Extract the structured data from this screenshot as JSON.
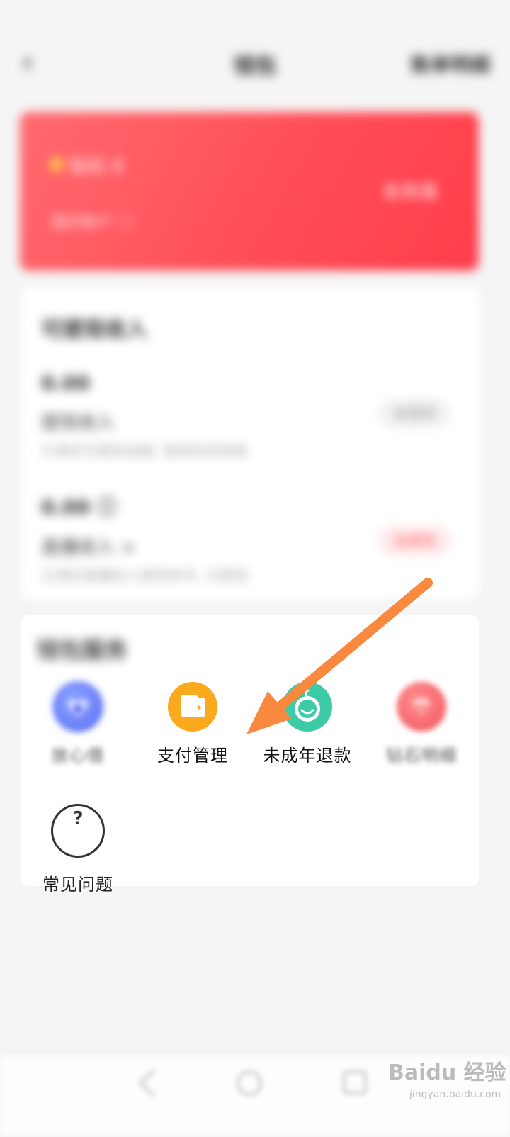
{
  "header": {
    "back_icon": "chevron-left-icon",
    "title": "钱包",
    "detail_link": "账单明细"
  },
  "wallet_card": {
    "balance_label": "钻石 0",
    "recharge_label": "去充值",
    "sub_label": "我的账户 ⓘ"
  },
  "income_card": {
    "heading": "可提现收入",
    "row1": {
      "title": "0.00",
      "sub": "提现收入",
      "desc": "已满足可提现金额, 提现后将到账",
      "button": "去提现"
    },
    "row2": {
      "title": "0.00 ⓘ",
      "sub": "直播收入 >",
      "desc": "已满足直播收入提现条件, 可提现",
      "button": "去提现"
    }
  },
  "services": {
    "title": "钱包服务",
    "items": [
      {
        "label": "放心借",
        "icon": "heart-shield-icon"
      },
      {
        "label": "支付管理",
        "icon": "wallet-icon"
      },
      {
        "label": "未成年退款",
        "icon": "baby-face-icon"
      },
      {
        "label": "钻石明细",
        "icon": "diamond-icon"
      },
      {
        "label": "常见问题",
        "icon": "question-circle-icon"
      }
    ]
  },
  "watermark": {
    "text": "Baidu 经验",
    "sub": "jingyan.baidu.com"
  },
  "colors": {
    "card_red": "#ff4e57",
    "arrow": "#f9893f",
    "orange_icon": "#fbaa1e",
    "green_icon": "#3ccba6"
  }
}
